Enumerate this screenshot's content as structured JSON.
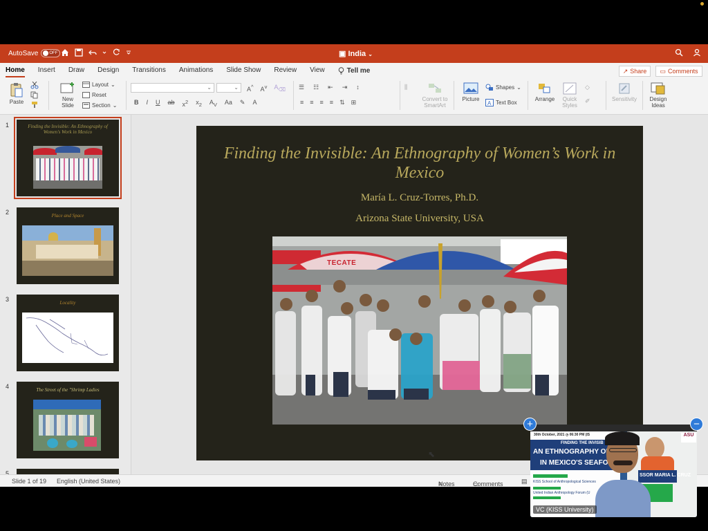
{
  "titlebar": {
    "autosave_label": "AutoSave",
    "autosave_state": "OFF",
    "doc_title": "India"
  },
  "ribbon": {
    "tabs": [
      "Home",
      "Insert",
      "Draw",
      "Design",
      "Transitions",
      "Animations",
      "Slide Show",
      "Review",
      "View"
    ],
    "tell_me": "Tell me",
    "share": "Share",
    "comments": "Comments",
    "paste": "Paste",
    "new_slide_1": "New",
    "new_slide_2": "Slide",
    "layout": "Layout",
    "reset": "Reset",
    "section": "Section",
    "convert_1": "Convert to",
    "convert_2": "SmartArt",
    "picture": "Picture",
    "shapes": "Shapes",
    "text_box": "Text Box",
    "arrange": "Arrange",
    "quick_1": "Quick",
    "quick_2": "Styles",
    "sensitivity": "Sensitivity",
    "design_1": "Design",
    "design_2": "Ideas"
  },
  "thumbnails": [
    {
      "num": "1",
      "title": "Finding the Invisible: An Ethnography of Women's Work in Mexico"
    },
    {
      "num": "2",
      "title": "Place and Space"
    },
    {
      "num": "3",
      "title": "Locality"
    },
    {
      "num": "4",
      "title": "The Street of the \"Shrimp Ladies"
    },
    {
      "num": "5",
      "title": ""
    }
  ],
  "slide": {
    "title": "Finding the Invisible: An Ethnography of Women’s Work in Mexico",
    "author": "María L. Cruz-Torres, Ph.D.",
    "affiliation": "Arizona State University, USA",
    "umbrella_brand": "TECATE"
  },
  "statusbar": {
    "slide_of": "Slide 1 of 19",
    "language": "English (United States)",
    "notes": "Notes",
    "comments": "Comments"
  },
  "video": {
    "label": "VC (KISS University)",
    "date": "30th October, 2021",
    "time": "06:30 PM (IS",
    "heading_1": "FINDING THE INVISIB",
    "heading_2": "AN ETHNOGRAPHY OF WO",
    "heading_3": "IN MEXICO'S SEAFOOD",
    "org_1": "KISS School of Anthropological Sciences",
    "org_2": "United Indian Anthropology Forum (U",
    "speaker": "SSOR MARIA L. CRUZ",
    "logo": "ASU"
  }
}
